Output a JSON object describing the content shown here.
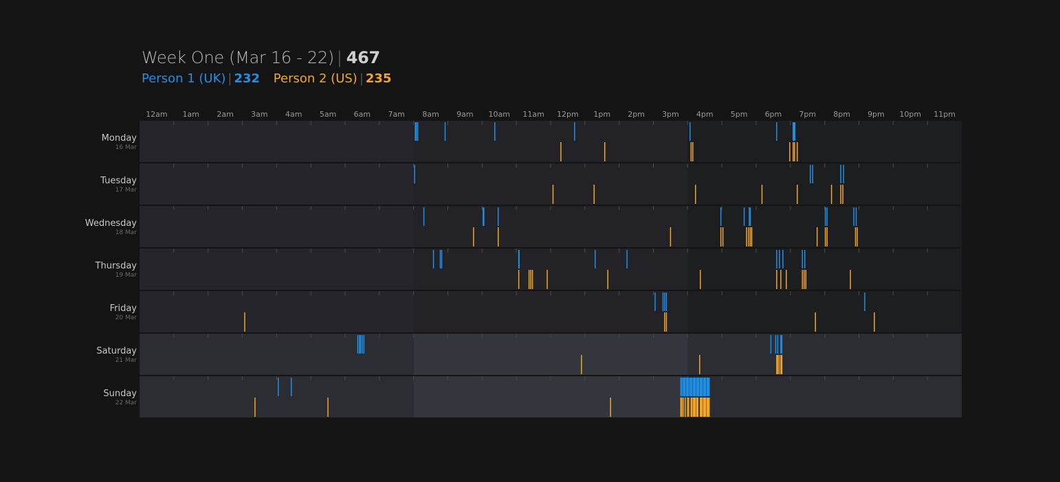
{
  "header": {
    "title": "Week One (Mar 16 - 22)",
    "total": "467",
    "person1_label": "Person 1 (UK)",
    "person1_count": "232",
    "person2_label": "Person 2 (US)",
    "person2_count": "235"
  },
  "colors": {
    "person1": "#1e90ea",
    "person2": "#f5a623",
    "background": "#141414",
    "row_weekday_night": "#25252b",
    "row_weekday_day": "#222227",
    "row_weekday_evening": "#1d1e20",
    "row_weekend_night": "#2b2d32",
    "row_weekend_day": "#34363d",
    "row_weekend_evening": "#2b2d32"
  },
  "chart_data": {
    "type": "timeline",
    "x_unit": "hour of day",
    "xlim": [
      0,
      24
    ],
    "hour_labels": [
      "12am",
      "1am",
      "2am",
      "3am",
      "4am",
      "5am",
      "6am",
      "7am",
      "8am",
      "9am",
      "10am",
      "11am",
      "12pm",
      "1pm",
      "2pm",
      "3pm",
      "4pm",
      "5pm",
      "6pm",
      "7pm",
      "8pm",
      "9pm",
      "10pm",
      "11pm"
    ],
    "day_bands_hours": [
      0,
      8,
      16,
      24
    ],
    "series": [
      {
        "name": "Person 1 (UK)",
        "color": "#1e90ea"
      },
      {
        "name": "Person 2 (US)",
        "color": "#f5a623"
      }
    ],
    "days": [
      {
        "name": "Monday",
        "date": "16 Mar",
        "weekend": false,
        "p1": [
          8.05,
          8.08,
          8.12,
          8.92,
          10.37,
          12.7,
          16.07,
          18.6,
          19.08,
          19.1,
          19.13
        ],
        "p2": [
          12.3,
          13.58,
          16.1,
          16.15,
          18.98,
          19.08,
          19.12,
          19.2
        ]
      },
      {
        "name": "Tuesday",
        "date": "17 Mar",
        "weekend": false,
        "p1": [
          8.03,
          19.58,
          19.65,
          20.47,
          20.55
        ],
        "p2": [
          12.07,
          13.27,
          16.23,
          18.17,
          19.2,
          20.2,
          20.47,
          20.53
        ]
      },
      {
        "name": "Wednesday",
        "date": "18 Mar",
        "weekend": false,
        "p1": [
          8.3,
          10.03,
          10.05,
          10.47,
          16.97,
          17.65,
          17.8,
          17.83,
          20.02,
          20.07,
          20.85,
          20.92
        ],
        "p2": [
          9.75,
          10.47,
          15.5,
          16.97,
          17.03,
          17.72,
          17.78,
          17.83,
          17.87,
          19.78,
          20.02,
          20.07,
          20.9,
          20.95
        ]
      },
      {
        "name": "Thursday",
        "date": "19 Mar",
        "weekend": false,
        "p1": [
          8.58,
          8.78,
          8.82,
          11.07,
          11.08,
          13.3,
          14.23,
          18.6,
          18.68,
          18.78,
          19.35,
          19.42
        ],
        "p2": [
          11.07,
          11.37,
          11.42,
          11.47,
          11.9,
          13.67,
          16.37,
          18.6,
          18.72,
          18.88,
          19.35,
          19.4,
          19.45,
          20.75
        ]
      },
      {
        "name": "Friday",
        "date": "20 Mar",
        "weekend": false,
        "p1": [
          15.05,
          15.28,
          15.33,
          15.38,
          21.17
        ],
        "p2": [
          3.07,
          15.33,
          15.38,
          19.73,
          21.45
        ]
      },
      {
        "name": "Saturday",
        "date": "21 Mar",
        "weekend": true,
        "p1": [
          6.37,
          6.42,
          6.45,
          6.5,
          6.55,
          18.43,
          18.57,
          18.63,
          18.72,
          18.75
        ],
        "p2": [
          12.9,
          16.35,
          18.6,
          18.63,
          18.67,
          18.72,
          18.75
        ]
      },
      {
        "name": "Sunday",
        "date": "22 Mar",
        "weekend": true,
        "p1": [
          4.05,
          4.43,
          15.8,
          15.83,
          15.87,
          15.9,
          15.93,
          15.97,
          16.0,
          16.03,
          16.07,
          16.1,
          16.13,
          16.17,
          16.2,
          16.23,
          16.27,
          16.3,
          16.33,
          16.37,
          16.4,
          16.43,
          16.47,
          16.5,
          16.53,
          16.57,
          16.6,
          16.63
        ],
        "p2": [
          3.37,
          5.5,
          13.75,
          15.8,
          15.83,
          15.87,
          15.93,
          16.0,
          16.03,
          16.1,
          16.13,
          16.17,
          16.2,
          16.23,
          16.27,
          16.3,
          16.37,
          16.4,
          16.43,
          16.47,
          16.5,
          16.53,
          16.57,
          16.6,
          16.63
        ]
      }
    ]
  }
}
